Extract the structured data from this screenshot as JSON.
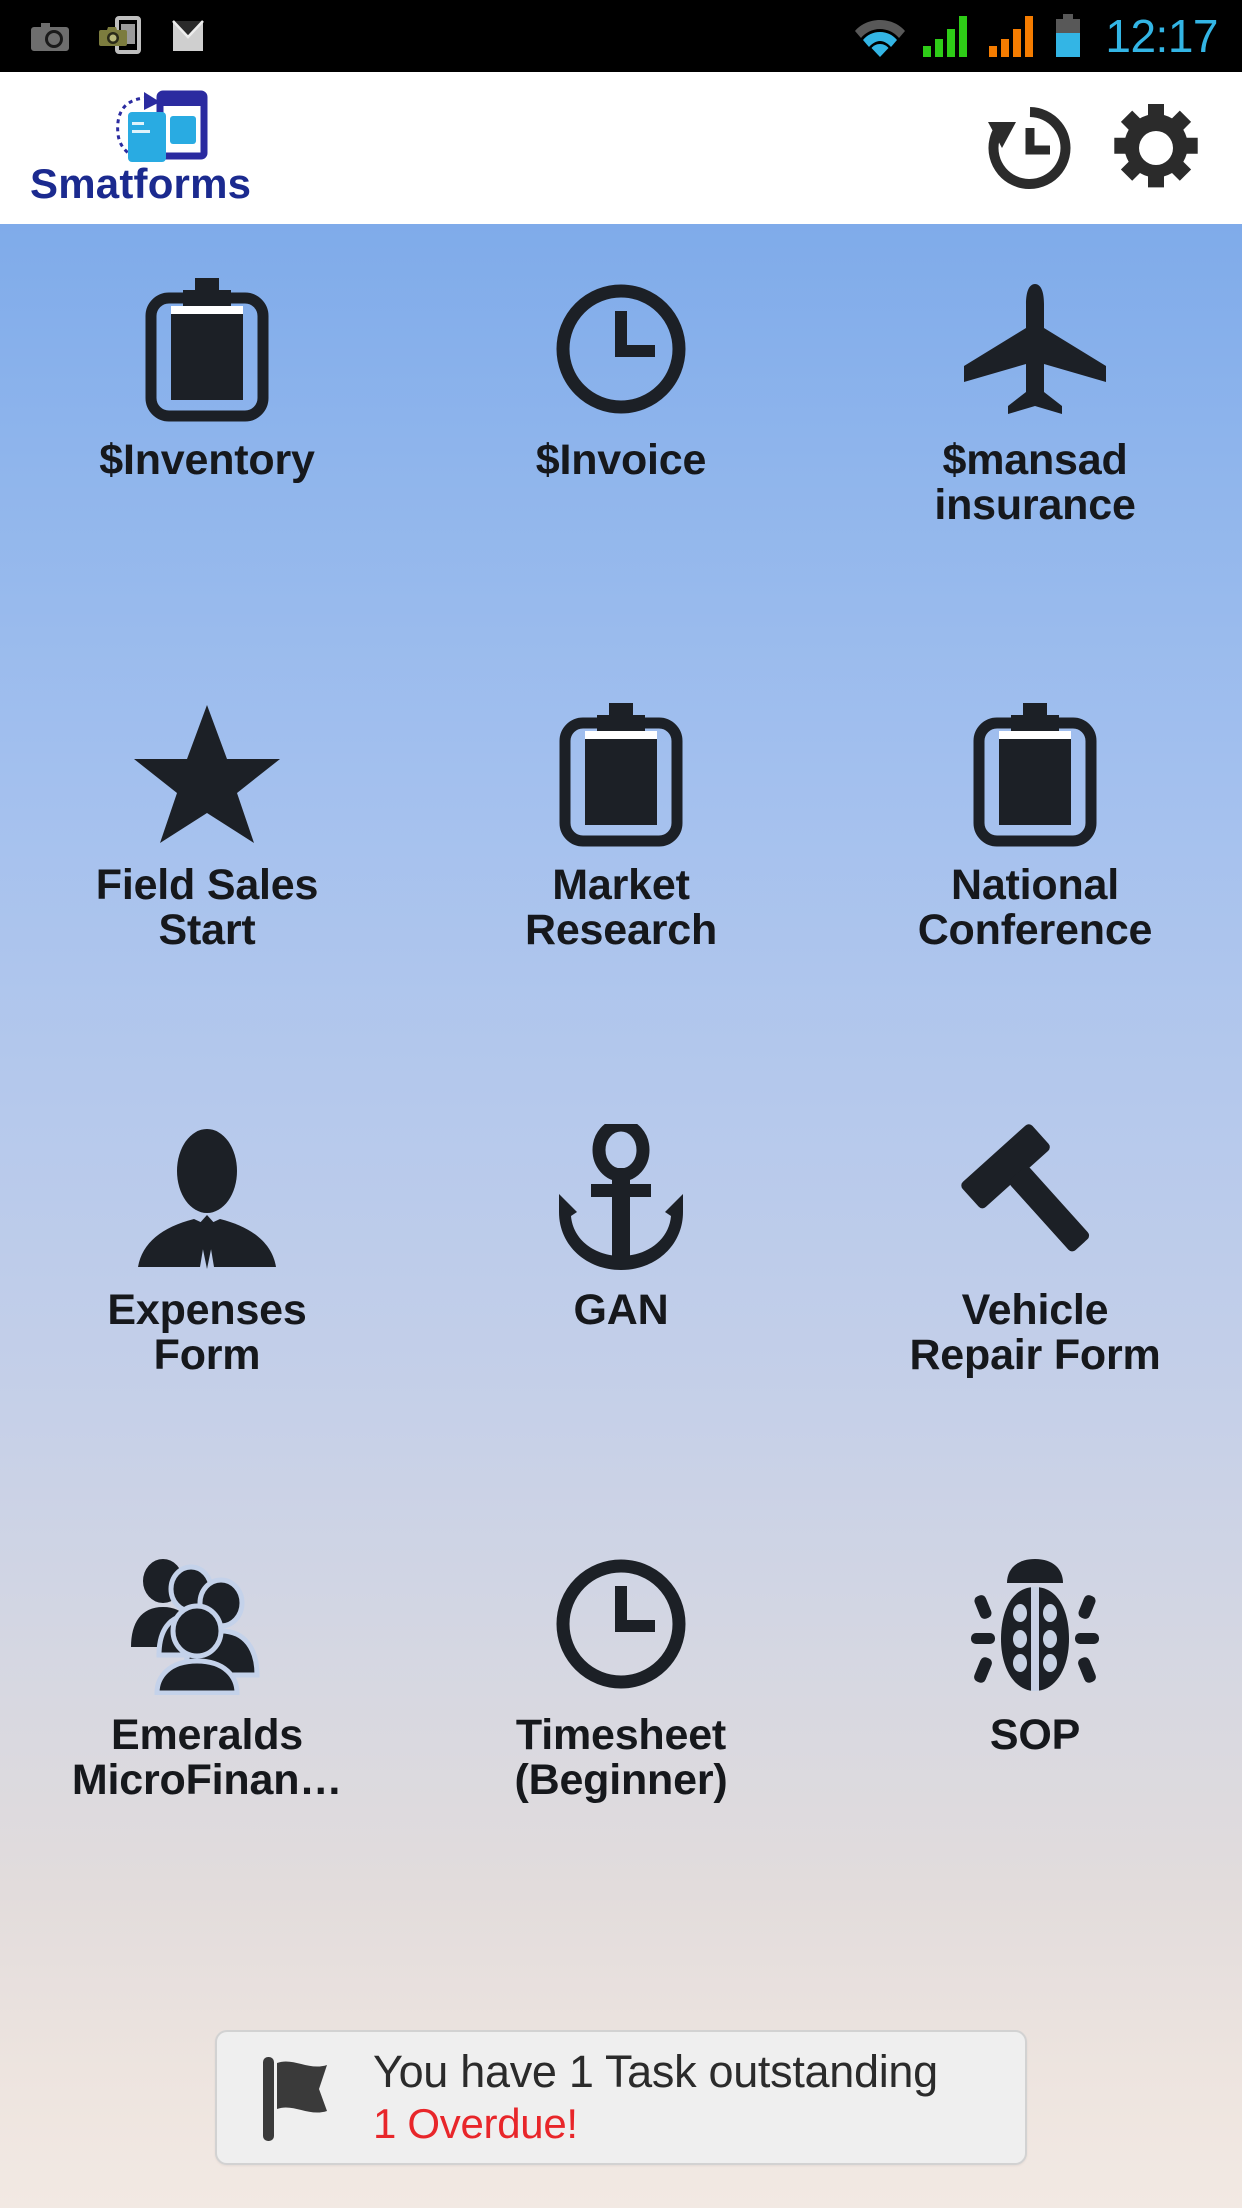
{
  "status_bar": {
    "icons": [
      "camera-icon",
      "camera-phone-icon",
      "envelope-icon",
      "wifi-icon",
      "signal-green-icon",
      "signal-orange-icon",
      "battery-icon"
    ],
    "time": "12:17",
    "colors": {
      "time": "#33B5E5",
      "wifi": "#33B5E5",
      "signal1": "#2ECC17",
      "signal2": "#F57C00",
      "battery": "#33B5E5",
      "background": "#000000"
    }
  },
  "header": {
    "brand_name": "Smatforms",
    "brand_color": "#1B2A8F",
    "logo_icon": "smatforms-logo",
    "actions": [
      {
        "name": "history-icon",
        "label": "History"
      },
      {
        "name": "gear-icon",
        "label": "Settings"
      }
    ]
  },
  "grid": {
    "tiles": [
      {
        "label": "$Inventory",
        "icon": "clipboard-icon"
      },
      {
        "label": "$Invoice",
        "icon": "clock-icon"
      },
      {
        "label": "$mansad\ninsurance",
        "icon": "airplane-icon"
      },
      {
        "label": "Field Sales\nStart",
        "icon": "star-icon"
      },
      {
        "label": "Market\nResearch",
        "icon": "clipboard-icon"
      },
      {
        "label": "National\nConference",
        "icon": "clipboard-icon"
      },
      {
        "label": "Expenses\nForm",
        "icon": "person-suit-icon"
      },
      {
        "label": "GAN",
        "icon": "anchor-icon"
      },
      {
        "label": "Vehicle\nRepair Form",
        "icon": "gavel-icon"
      },
      {
        "label": "Emeralds\nMicroFinan…",
        "icon": "group-people-icon"
      },
      {
        "label": "Timesheet\n(Beginner)",
        "icon": "clock-icon"
      },
      {
        "label": "SOP",
        "icon": "bug-icon"
      }
    ]
  },
  "task_card": {
    "flag_icon": "flag-icon",
    "message": "You have 1 Task outstanding",
    "overdue": "1 Overdue!",
    "overdue_color": "#E8262A"
  },
  "background": {
    "top": "#7FABEA",
    "bottom": "#F2E9E3"
  }
}
